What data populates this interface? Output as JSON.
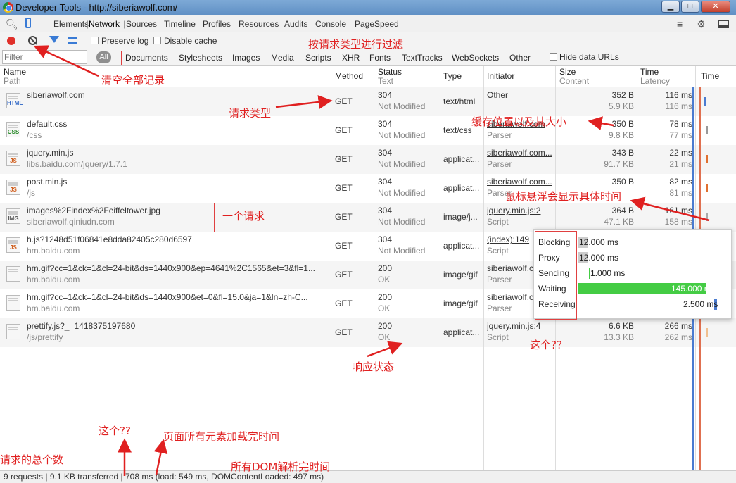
{
  "window": {
    "title": "Developer Tools - http://siberiawolf.com/",
    "minimize": "▁",
    "maximize": "□",
    "close": "✕"
  },
  "tabs": [
    "Elements",
    "Network",
    "Sources",
    "Timeline",
    "Profiles",
    "Resources",
    "Audits",
    "Console",
    "PageSpeed"
  ],
  "tabbar_icons": {
    "search": "search-icon",
    "device": "device-icon",
    "drawer": "drawer-icon",
    "settings": "gear-icon",
    "dock": "dock-icon"
  },
  "toolbar": {
    "preserve_log": "Preserve log",
    "disable_cache": "Disable cache"
  },
  "filter": {
    "placeholder": "Filter",
    "all": "All",
    "types": [
      "Documents",
      "Stylesheets",
      "Images",
      "Media",
      "Scripts",
      "XHR",
      "Fonts",
      "TextTracks",
      "WebSockets",
      "Other"
    ],
    "hide_data_urls": "Hide data URLs"
  },
  "columns": {
    "name": "Name",
    "path": "Path",
    "method": "Method",
    "status": "Status",
    "text": "Text",
    "type": "Type",
    "initiator": "Initiator",
    "size": "Size",
    "content": "Content",
    "time": "Time",
    "latency": "Latency",
    "timeline": "Time"
  },
  "requests": [
    {
      "name": "siberiawolf.com",
      "path": "",
      "icon": "HTML",
      "method": "GET",
      "status": "304",
      "text": "Not Modified",
      "type": "text/html",
      "initiator": "Other",
      "initiator_sub": "",
      "size": "352 B",
      "content": "5.9 KB",
      "time": "116 ms",
      "latency": "116 ms",
      "bar_color": "#4a7bd0"
    },
    {
      "name": "default.css",
      "path": "/css",
      "icon": "CSS",
      "method": "GET",
      "status": "304",
      "text": "Not Modified",
      "type": "text/css",
      "initiator": "siberiawolf.com",
      "initiator_sub": "Parser",
      "size": "350 B",
      "content": "9.8 KB",
      "time": "78 ms",
      "latency": "77 ms",
      "bar_color": "#999999"
    },
    {
      "name": "jquery.min.js",
      "path": "libs.baidu.com/jquery/1.7.1",
      "icon": "JS",
      "method": "GET",
      "status": "304",
      "text": "Not Modified",
      "type": "applicat...",
      "initiator": "siberiawolf.com...",
      "initiator_sub": "Parser",
      "size": "343 B",
      "content": "91.7 KB",
      "time": "22 ms",
      "latency": "21 ms",
      "bar_color": "#e07030"
    },
    {
      "name": "post.min.js",
      "path": "/js",
      "icon": "JS",
      "method": "GET",
      "status": "304",
      "text": "Not Modified",
      "type": "applicat...",
      "initiator": "siberiawolf.com...",
      "initiator_sub": "Parser",
      "size": "350 B",
      "content": "",
      "time": "82 ms",
      "latency": "81 ms",
      "bar_color": "#e07030"
    },
    {
      "name": "images%2Findex%2Feiffeltower.jpg",
      "path": "siberiawolf.qiniudn.com",
      "icon": "IMG",
      "method": "GET",
      "status": "304",
      "text": "Not Modified",
      "type": "image/j...",
      "initiator": "jquery.min.js:2",
      "initiator_sub": "Script",
      "size": "364 B",
      "content": "47.1 KB",
      "time": "161 ms",
      "latency": "158 ms",
      "bar_color": "#aaaaaa"
    },
    {
      "name": "h.js?1248d51f06841e8dda82405c280d6597",
      "path": "hm.baidu.com",
      "icon": "JS",
      "method": "GET",
      "status": "304",
      "text": "Not Modified",
      "type": "applicat...",
      "initiator": "(index):149",
      "initiator_sub": "Script",
      "size": "",
      "content": "",
      "time": "",
      "latency": "",
      "bar_color": ""
    },
    {
      "name": "hm.gif?cc=1&ck=1&cl=24-bit&ds=1440x900&ep=4641%2C1565&et=3&fl=1...",
      "path": "hm.baidu.com",
      "icon": "",
      "method": "GET",
      "status": "200",
      "text": "OK",
      "type": "image/gif",
      "initiator": "siberiawolf.c",
      "initiator_sub": "Parser",
      "size": "",
      "content": "",
      "time": "",
      "latency": "",
      "bar_color": ""
    },
    {
      "name": "hm.gif?cc=1&ck=1&cl=24-bit&ds=1440x900&et=0&fl=15.0&ja=1&ln=zh-C...",
      "path": "hm.baidu.com",
      "icon": "",
      "method": "GET",
      "status": "200",
      "text": "OK",
      "type": "image/gif",
      "initiator": "siberiawolf.c",
      "initiator_sub": "Parser",
      "size": "",
      "content": "",
      "time": "",
      "latency": "",
      "bar_color": ""
    },
    {
      "name": "prettify.js?_=1418375197680",
      "path": "/js/prettify",
      "icon": "",
      "method": "GET",
      "status": "200",
      "text": "OK",
      "type": "applicat...",
      "initiator": "jquery.min.js:4",
      "initiator_sub": "Script",
      "size": "6.6 KB",
      "content": "13.3 KB",
      "time": "266 ms",
      "latency": "262 ms",
      "bar_color": "#f0c090"
    }
  ],
  "tooltip": [
    {
      "label": "Blocking",
      "value": "12.000 ms",
      "fill": 0.08,
      "color": "#cccccc"
    },
    {
      "label": "Proxy",
      "value": "12.000 ms",
      "fill": 0.08,
      "color": "#cccccc"
    },
    {
      "label": "Sending",
      "value": "1.000 ms",
      "fill": 0.01,
      "color": "#44cc44"
    },
    {
      "label": "Waiting",
      "value": "145.000 ms",
      "fill": 1.0,
      "color": "#44cc44"
    },
    {
      "label": "Receiving",
      "value": "2.500 ms",
      "fill": 0.02,
      "color": "#4a7bd0"
    }
  ],
  "statusbar": "9 requests | 9.1 KB transferred | 708 ms (load: 549 ms, DOMContentLoaded: 497 ms)",
  "annotations": {
    "filter_by_type": "按请求类型进行过滤",
    "clear_all": "清空全部记录",
    "request_type": "请求类型",
    "cache_location": "缓存位置以及其大小",
    "hover_detail": "鼠标悬浮会显示具体时间",
    "one_request": "一个请求",
    "what_this_1": "这个??",
    "response_status": "响应状态",
    "what_this_2": "这个??",
    "page_load_time": "页面所有元素加载完时间",
    "total_requests": "请求的总个数",
    "dom_parsed": "所有DOM解析完时间"
  },
  "colors": {
    "record": "#e0302a",
    "annotation": "#e02020",
    "dom_line": "#4a7bd0",
    "load_line": "#e07050"
  }
}
